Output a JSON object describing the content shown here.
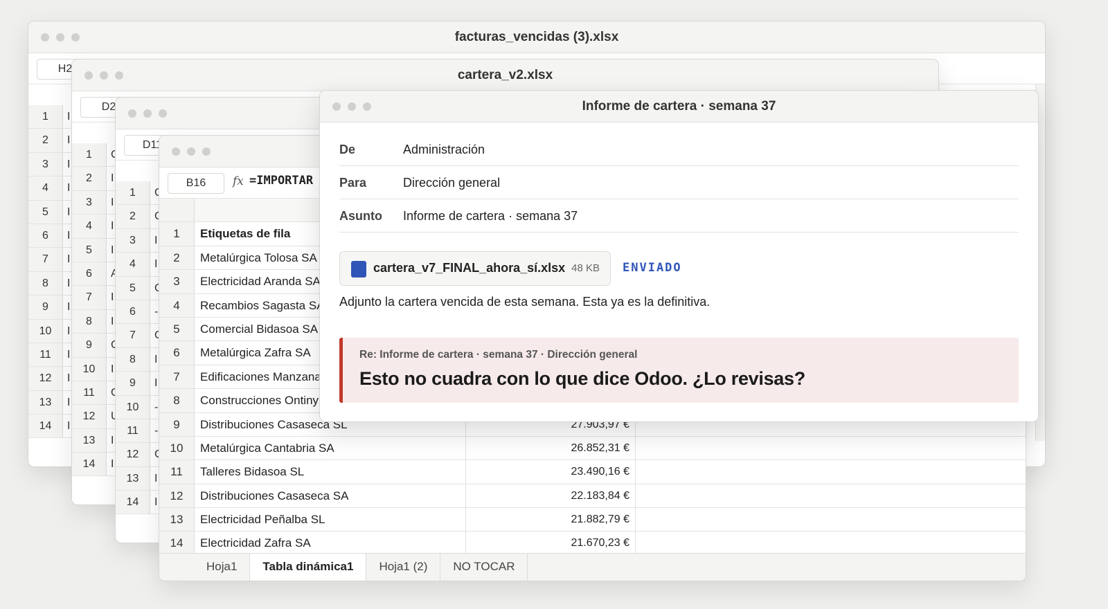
{
  "windows": {
    "w1": {
      "title": "facturas_vencidas (3).xlsx",
      "cell_ref": "H2",
      "rows": [
        "1",
        "2",
        "3",
        "4",
        "5",
        "6",
        "7",
        "8",
        "9",
        "10",
        "11",
        "12",
        "13",
        "14"
      ],
      "col_initials": [
        "I",
        "I",
        "I",
        "I",
        "I",
        "I",
        "I",
        "I",
        "I",
        "I",
        "I",
        "I",
        "I",
        "I"
      ]
    },
    "w2": {
      "title": "cartera_v2.xlsx",
      "cell_ref": "D2",
      "rows": [
        "1",
        "2",
        "3",
        "4",
        "5",
        "6",
        "7",
        "8",
        "9",
        "10",
        "11",
        "12",
        "13",
        "14"
      ],
      "col_initials": [
        "C",
        "I",
        "I",
        "I",
        "I",
        "A",
        "I",
        "I",
        "C",
        "I",
        "C",
        "U",
        "I",
        "I"
      ]
    },
    "w3": {
      "cell_ref": "D11",
      "rows": [
        "1",
        "2",
        "3",
        "4",
        "5",
        "6",
        "7",
        "8",
        "9",
        "10",
        "11",
        "12",
        "13",
        "14"
      ],
      "col_initials": [
        "C",
        "C",
        "I",
        "I",
        "C",
        "-",
        "C",
        "I",
        "I",
        "-",
        "-",
        "C",
        "I",
        "I"
      ]
    },
    "w4": {
      "cell_ref": "B16",
      "fx": "fx",
      "formula": "=IMPORTAR",
      "rows": [
        {
          "n": "1",
          "label": "Etiquetas de fila",
          "value": ""
        },
        {
          "n": "2",
          "label": "Metalúrgica Tolosa SA",
          "value": ""
        },
        {
          "n": "3",
          "label": "Electricidad Aranda SA",
          "value": ""
        },
        {
          "n": "4",
          "label": "Recambios Sagasta SA",
          "value": ""
        },
        {
          "n": "5",
          "label": "Comercial Bidasoa SA",
          "value": ""
        },
        {
          "n": "6",
          "label": "Metalúrgica Zafra SA",
          "value": ""
        },
        {
          "n": "7",
          "label": "Edificaciones Manzana",
          "value": ""
        },
        {
          "n": "8",
          "label": "Construcciones Ontiny",
          "value": ""
        },
        {
          "n": "9",
          "label": "Distribuciones Casaseca SL",
          "value": "27.903,97 €"
        },
        {
          "n": "10",
          "label": "Metalúrgica Cantabria SA",
          "value": "26.852,31 €"
        },
        {
          "n": "11",
          "label": "Talleres Bidasoa SL",
          "value": "23.490,16 €"
        },
        {
          "n": "12",
          "label": "Distribuciones Casaseca SA",
          "value": "22.183,84 €"
        },
        {
          "n": "13",
          "label": "Electricidad Peñalba SL",
          "value": "21.882,79 €"
        },
        {
          "n": "14",
          "label": "Electricidad Zafra SA",
          "value": "21.670,23 €"
        }
      ],
      "tabs": [
        "Hoja1",
        "Tabla dinámica1",
        "Hoja1 (2)",
        "NO TOCAR"
      ],
      "active_tab": "Tabla dinámica1"
    }
  },
  "email": {
    "title": "Informe de cartera · semana 37",
    "from_label": "De",
    "from": "Administración",
    "to_label": "Para",
    "to": "Dirección general",
    "subject_label": "Asunto",
    "subject": "Informe de cartera · semana 37",
    "attachment": {
      "name": "cartera_v7_FINAL_ahora_sí.xlsx",
      "size": "48 KB",
      "icon": "spreadsheet-file-icon",
      "color": "#2f55b8"
    },
    "status": "ENVIADO",
    "body": "Adjunto la cartera vencida de esta semana. Esta ya es la definitiva.",
    "reply": {
      "meta": "Re: Informe de cartera · semana 37 · Dirección general",
      "message": "Esto no cuadra con lo que dice Odoo. ¿Lo revisas?",
      "accent": "#c0392b"
    }
  }
}
